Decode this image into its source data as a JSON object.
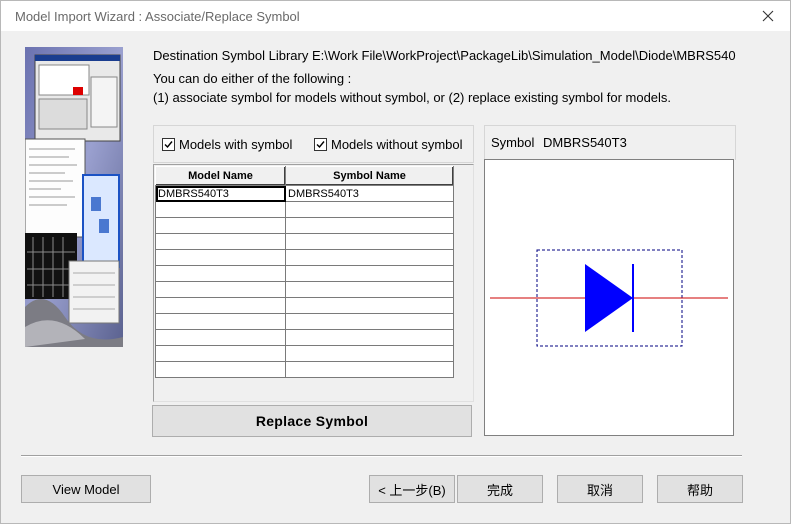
{
  "window": {
    "title": "Model Import Wizard : Associate/Replace Symbol"
  },
  "info": {
    "destination": "Destination Symbol Library E:\\Work File\\WorkProject\\PackageLib\\Simulation_Model\\Diode\\MBRS540",
    "line1": "You can do either of the following :",
    "line2": "(1) associate symbol for models without symbol, or (2) replace existing symbol for models."
  },
  "filters": {
    "with_symbol": {
      "label": "Models with symbol",
      "checked": true
    },
    "without_symbol": {
      "label": "Models without symbol",
      "checked": true
    }
  },
  "grid": {
    "columns": [
      "Model Name",
      "Symbol Name"
    ],
    "rows": [
      [
        "DMBRS540T3",
        "DMBRS540T3"
      ],
      [
        "",
        ""
      ],
      [
        "",
        ""
      ],
      [
        "",
        ""
      ],
      [
        "",
        ""
      ],
      [
        "",
        ""
      ],
      [
        "",
        ""
      ],
      [
        "",
        ""
      ],
      [
        "",
        ""
      ],
      [
        "",
        ""
      ],
      [
        "",
        ""
      ],
      [
        "",
        ""
      ]
    ]
  },
  "buttons": {
    "replace": "Replace Symbol",
    "view_model": "View Model",
    "back": "< 上一步(B)",
    "finish": "完成",
    "cancel": "取消",
    "help": "帮助"
  },
  "symbol": {
    "label": "Symbol",
    "name": "DMBRS540T3",
    "colors": {
      "body": "#0000ff",
      "pins": "#cc0000",
      "outline": "#000080"
    }
  },
  "icons": [
    "close-icon",
    "checkmark-icon",
    "diode-symbol"
  ]
}
